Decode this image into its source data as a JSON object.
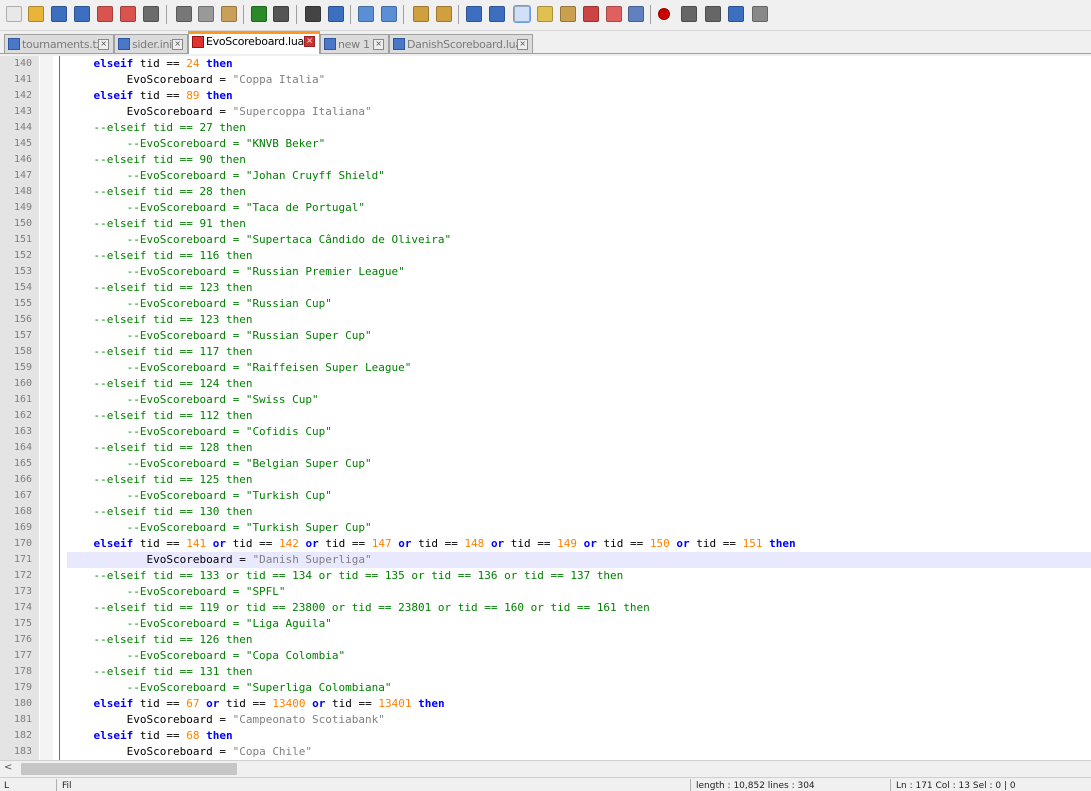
{
  "toolbar": {
    "buttons": [
      {
        "name": "new-file-icon",
        "color": "#e8e8e8"
      },
      {
        "name": "open-file-icon",
        "color": "#e8b53a"
      },
      {
        "name": "save-icon",
        "color": "#3d6fc1"
      },
      {
        "name": "save-all-icon",
        "color": "#3d6fc1"
      },
      {
        "name": "close-icon",
        "color": "#d9534f"
      },
      {
        "name": "close-all-icon",
        "color": "#d9534f"
      },
      {
        "name": "print-icon",
        "color": "#6c6c6c"
      },
      {
        "name": "cut-icon",
        "color": "#777777"
      },
      {
        "name": "copy-icon",
        "color": "#999999"
      },
      {
        "name": "paste-icon",
        "color": "#c9a05a"
      },
      {
        "name": "undo-icon",
        "color": "#2a8a2a"
      },
      {
        "name": "redo-icon",
        "color": "#555555"
      },
      {
        "name": "find-icon",
        "color": "#444444"
      },
      {
        "name": "replace-icon",
        "color": "#3d6fc1"
      },
      {
        "name": "zoom-in-icon",
        "color": "#5a8fd6"
      },
      {
        "name": "zoom-out-icon",
        "color": "#5a8fd6"
      },
      {
        "name": "sync-vertical-icon",
        "color": "#d0a040"
      },
      {
        "name": "sync-horizontal-icon",
        "color": "#d0a040"
      },
      {
        "name": "word-wrap-icon",
        "color": "#3d6fc1"
      },
      {
        "name": "show-all-chars-icon",
        "color": "#3d6fc1"
      },
      {
        "name": "indent-guide-icon",
        "color": "#3d6fc1"
      },
      {
        "name": "udl-icon",
        "color": "#e0c050"
      },
      {
        "name": "doc-map-icon",
        "color": "#c8a050"
      },
      {
        "name": "function-list-icon",
        "color": "#cc4444"
      },
      {
        "name": "folder-workspace-icon",
        "color": "#e06060"
      },
      {
        "name": "monitoring-icon",
        "color": "#6080c0"
      },
      {
        "name": "record-macro-icon",
        "color": "#cc0000"
      },
      {
        "name": "stop-record-icon",
        "color": "#666666"
      },
      {
        "name": "play-macro-icon",
        "color": "#666666"
      },
      {
        "name": "run-macro-multiple-icon",
        "color": "#3d6fc1"
      },
      {
        "name": "save-macro-icon",
        "color": "#888888"
      }
    ]
  },
  "tabs": [
    {
      "label": "tournaments.txt",
      "active": false
    },
    {
      "label": "sider.ini",
      "active": false
    },
    {
      "label": "EvoScoreboard.lua",
      "active": true
    },
    {
      "label": "new 1",
      "active": false
    },
    {
      "label": "DanishScoreboard.lua",
      "active": false
    }
  ],
  "tab_close_glyph": "×",
  "editor": {
    "current_line": 171,
    "lines": [
      {
        "n": "140",
        "indent": "    ",
        "tokens": [
          {
            "t": "elseif",
            "c": "kw"
          },
          {
            "t": " tid == "
          },
          {
            "t": "24",
            "c": "num"
          },
          {
            "t": " "
          },
          {
            "t": "then",
            "c": "kw"
          }
        ]
      },
      {
        "n": "141",
        "indent": "         ",
        "tokens": [
          {
            "t": "EvoScoreboard = "
          },
          {
            "t": "\"Coppa Italia\"",
            "c": "str"
          }
        ]
      },
      {
        "n": "142",
        "indent": "    ",
        "tokens": [
          {
            "t": "elseif",
            "c": "kw"
          },
          {
            "t": " tid == "
          },
          {
            "t": "89",
            "c": "num"
          },
          {
            "t": " "
          },
          {
            "t": "then",
            "c": "kw"
          }
        ]
      },
      {
        "n": "143",
        "indent": "         ",
        "tokens": [
          {
            "t": "EvoScoreboard = "
          },
          {
            "t": "\"Supercoppa Italiana\"",
            "c": "str"
          }
        ]
      },
      {
        "n": "144",
        "indent": "    ",
        "tokens": [
          {
            "t": "--elseif tid == 27 then",
            "c": "cm"
          }
        ]
      },
      {
        "n": "145",
        "indent": "         ",
        "tokens": [
          {
            "t": "--EvoScoreboard = \"KNVB Beker\"",
            "c": "cm"
          }
        ]
      },
      {
        "n": "146",
        "indent": "    ",
        "tokens": [
          {
            "t": "--elseif tid == 90 then",
            "c": "cm"
          }
        ]
      },
      {
        "n": "147",
        "indent": "         ",
        "tokens": [
          {
            "t": "--EvoScoreboard = \"Johan Cruyff Shield\"",
            "c": "cm"
          }
        ]
      },
      {
        "n": "148",
        "indent": "    ",
        "tokens": [
          {
            "t": "--elseif tid == 28 then",
            "c": "cm"
          }
        ]
      },
      {
        "n": "149",
        "indent": "         ",
        "tokens": [
          {
            "t": "--EvoScoreboard = \"Taca de Portugal\"",
            "c": "cm"
          }
        ]
      },
      {
        "n": "150",
        "indent": "    ",
        "tokens": [
          {
            "t": "--elseif tid == 91 then",
            "c": "cm"
          }
        ]
      },
      {
        "n": "151",
        "indent": "         ",
        "tokens": [
          {
            "t": "--EvoScoreboard = \"Supertaca Cândido de Oliveira\"",
            "c": "cm"
          }
        ]
      },
      {
        "n": "152",
        "indent": "    ",
        "tokens": [
          {
            "t": "--elseif tid == 116 then",
            "c": "cm"
          }
        ]
      },
      {
        "n": "153",
        "indent": "         ",
        "tokens": [
          {
            "t": "--EvoScoreboard = \"Russian Premier League\"",
            "c": "cm"
          }
        ]
      },
      {
        "n": "154",
        "indent": "    ",
        "tokens": [
          {
            "t": "--elseif tid == 123 then",
            "c": "cm"
          }
        ]
      },
      {
        "n": "155",
        "indent": "         ",
        "tokens": [
          {
            "t": "--EvoScoreboard = \"Russian Cup\"",
            "c": "cm"
          }
        ]
      },
      {
        "n": "156",
        "indent": "    ",
        "tokens": [
          {
            "t": "--elseif tid == 123 then",
            "c": "cm"
          }
        ]
      },
      {
        "n": "157",
        "indent": "         ",
        "tokens": [
          {
            "t": "--EvoScoreboard = \"Russian Super Cup\"",
            "c": "cm"
          }
        ]
      },
      {
        "n": "158",
        "indent": "    ",
        "tokens": [
          {
            "t": "--elseif tid == 117 then",
            "c": "cm"
          }
        ]
      },
      {
        "n": "159",
        "indent": "         ",
        "tokens": [
          {
            "t": "--EvoScoreboard = \"Raiffeisen Super League\"",
            "c": "cm"
          }
        ]
      },
      {
        "n": "160",
        "indent": "    ",
        "tokens": [
          {
            "t": "--elseif tid == 124 then",
            "c": "cm"
          }
        ]
      },
      {
        "n": "161",
        "indent": "         ",
        "tokens": [
          {
            "t": "--EvoScoreboard = \"Swiss Cup\"",
            "c": "cm"
          }
        ]
      },
      {
        "n": "162",
        "indent": "    ",
        "tokens": [
          {
            "t": "--elseif tid == 112 then",
            "c": "cm"
          }
        ]
      },
      {
        "n": "163",
        "indent": "         ",
        "tokens": [
          {
            "t": "--EvoScoreboard = \"Cofidis Cup\"",
            "c": "cm"
          }
        ]
      },
      {
        "n": "164",
        "indent": "    ",
        "tokens": [
          {
            "t": "--elseif tid == 128 then",
            "c": "cm"
          }
        ]
      },
      {
        "n": "165",
        "indent": "         ",
        "tokens": [
          {
            "t": "--EvoScoreboard = \"Belgian Super Cup\"",
            "c": "cm"
          }
        ]
      },
      {
        "n": "166",
        "indent": "    ",
        "tokens": [
          {
            "t": "--elseif tid == 125 then",
            "c": "cm"
          }
        ]
      },
      {
        "n": "167",
        "indent": "         ",
        "tokens": [
          {
            "t": "--EvoScoreboard = \"Turkish Cup\"",
            "c": "cm"
          }
        ]
      },
      {
        "n": "168",
        "indent": "    ",
        "tokens": [
          {
            "t": "--elseif tid == 130 then",
            "c": "cm"
          }
        ]
      },
      {
        "n": "169",
        "indent": "         ",
        "tokens": [
          {
            "t": "--EvoScoreboard = \"Turkish Super Cup\"",
            "c": "cm"
          }
        ]
      },
      {
        "n": "170",
        "indent": "    ",
        "tokens": [
          {
            "t": "elseif",
            "c": "kw"
          },
          {
            "t": " tid == "
          },
          {
            "t": "141",
            "c": "num"
          },
          {
            "t": " "
          },
          {
            "t": "or",
            "c": "kw"
          },
          {
            "t": " tid == "
          },
          {
            "t": "142",
            "c": "num"
          },
          {
            "t": " "
          },
          {
            "t": "or",
            "c": "kw"
          },
          {
            "t": " tid == "
          },
          {
            "t": "147",
            "c": "num"
          },
          {
            "t": " "
          },
          {
            "t": "or",
            "c": "kw"
          },
          {
            "t": " tid == "
          },
          {
            "t": "148",
            "c": "num"
          },
          {
            "t": " "
          },
          {
            "t": "or",
            "c": "kw"
          },
          {
            "t": " tid == "
          },
          {
            "t": "149",
            "c": "num"
          },
          {
            "t": " "
          },
          {
            "t": "or",
            "c": "kw"
          },
          {
            "t": " tid == "
          },
          {
            "t": "150",
            "c": "num"
          },
          {
            "t": " "
          },
          {
            "t": "or",
            "c": "kw"
          },
          {
            "t": " tid == "
          },
          {
            "t": "151",
            "c": "num"
          },
          {
            "t": " "
          },
          {
            "t": "then",
            "c": "kw"
          }
        ]
      },
      {
        "n": "171",
        "indent": "            ",
        "tokens": [
          {
            "t": "EvoScoreboard = "
          },
          {
            "t": "\"Danish Superliga\"",
            "c": "str"
          }
        ]
      },
      {
        "n": "172",
        "indent": "    ",
        "tokens": [
          {
            "t": "--elseif tid == 133 or tid == 134 or tid == 135 or tid == 136 or tid == 137 then",
            "c": "cm"
          }
        ]
      },
      {
        "n": "173",
        "indent": "         ",
        "tokens": [
          {
            "t": "--EvoScoreboard = \"SPFL\"",
            "c": "cm"
          }
        ]
      },
      {
        "n": "174",
        "indent": "    ",
        "tokens": [
          {
            "t": "--elseif tid == 119 or tid == 23800 or tid == 23801 or tid == 160 or tid == 161 then",
            "c": "cm"
          }
        ]
      },
      {
        "n": "175",
        "indent": "         ",
        "tokens": [
          {
            "t": "--EvoScoreboard = \"Liga Aguila\"",
            "c": "cm"
          }
        ]
      },
      {
        "n": "176",
        "indent": "    ",
        "tokens": [
          {
            "t": "--elseif tid == 126 then",
            "c": "cm"
          }
        ]
      },
      {
        "n": "177",
        "indent": "         ",
        "tokens": [
          {
            "t": "--EvoScoreboard = \"Copa Colombia\"",
            "c": "cm"
          }
        ]
      },
      {
        "n": "178",
        "indent": "    ",
        "tokens": [
          {
            "t": "--elseif tid == 131 then",
            "c": "cm"
          }
        ]
      },
      {
        "n": "179",
        "indent": "         ",
        "tokens": [
          {
            "t": "--EvoScoreboard = \"Superliga Colombiana\"",
            "c": "cm"
          }
        ]
      },
      {
        "n": "180",
        "indent": "    ",
        "tokens": [
          {
            "t": "elseif",
            "c": "kw"
          },
          {
            "t": " tid == "
          },
          {
            "t": "67",
            "c": "num"
          },
          {
            "t": " "
          },
          {
            "t": "or",
            "c": "kw"
          },
          {
            "t": " tid == "
          },
          {
            "t": "13400",
            "c": "num"
          },
          {
            "t": " "
          },
          {
            "t": "or",
            "c": "kw"
          },
          {
            "t": " tid == "
          },
          {
            "t": "13401",
            "c": "num"
          },
          {
            "t": " "
          },
          {
            "t": "then",
            "c": "kw"
          }
        ]
      },
      {
        "n": "181",
        "indent": "         ",
        "tokens": [
          {
            "t": "EvoScoreboard = "
          },
          {
            "t": "\"Campeonato Scotiabank\"",
            "c": "str"
          }
        ]
      },
      {
        "n": "182",
        "indent": "    ",
        "tokens": [
          {
            "t": "elseif",
            "c": "kw"
          },
          {
            "t": " tid == "
          },
          {
            "t": "68",
            "c": "num"
          },
          {
            "t": " "
          },
          {
            "t": "then",
            "c": "kw"
          }
        ]
      },
      {
        "n": "183",
        "indent": "         ",
        "tokens": [
          {
            "t": "EvoScoreboard = "
          },
          {
            "t": "\"Copa Chile\"",
            "c": "str"
          }
        ]
      }
    ]
  },
  "scrollbar": {
    "left_arrow": "<"
  },
  "statusbar": {
    "cells": [
      {
        "text": "L",
        "name": "status-left"
      },
      {
        "text": "Fil",
        "name": "status-filetype"
      },
      {
        "text": "length : 10,852    lines : 304",
        "name": "status-length"
      },
      {
        "text": "Ln : 171    Col : 13    Sel : 0 | 0",
        "name": "status-position"
      }
    ]
  }
}
